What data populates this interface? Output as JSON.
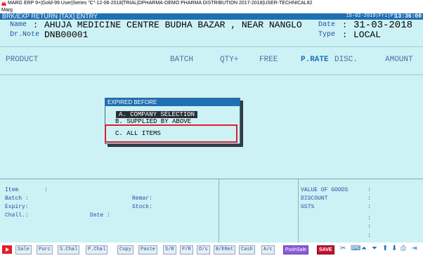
{
  "window": {
    "title": "MARG ERP 9+|Gold-99 User|Series \"C\"-12-06-2018|TRIAL|DPHARMA-DEMO PHARMA DISTRIBUTION 2017-2018|USER-TECHNICAL82",
    "menu": "Marg"
  },
  "header": {
    "title": "BRK/EXP RETURN [TAX] ENTRY",
    "date": "15-02-2019|Fri|P|",
    "time": "13:36:00"
  },
  "party": {
    "name_label": "Name",
    "name_value": "AHUJA MEDICINE CENTRE BUDHA BAZAR , NEAR NANGLO",
    "note_label": "Dr.Note :",
    "note_value": "DNB00001",
    "date_label": "Date",
    "date_value": "31-03-2018",
    "type_label": "Type",
    "type_value": "LOCAL"
  },
  "columns": {
    "product": "PRODUCT",
    "batch": "BATCH",
    "qty": "QTY+",
    "free": "FREE",
    "prate": "P.RATE",
    "disc": "DISC.",
    "amount": "AMOUNT"
  },
  "footer": {
    "item": "Item",
    "batch": "Batch :",
    "expiry": "Expiry:",
    "chall": "Chall.:",
    "date": "Date :",
    "remar": "Remar:",
    "stock": "Stock:",
    "value_of_goods": "VALUE OF GOODS",
    "discount": "DISCOUNT",
    "gst": "GST%"
  },
  "popup": {
    "title": "EXPIRED BEFORE",
    "options": [
      {
        "label": "A. COMPANY SELECTION",
        "selected": true
      },
      {
        "label": "B. SUPPLIED BY ABOVE",
        "selected": false
      },
      {
        "label": "C. ALL ITEMS",
        "selected": false
      }
    ]
  },
  "toolbar": {
    "buttons": [
      "Sale",
      "Purc",
      "S.Chal",
      "P.Chal",
      "Copy",
      "Paste",
      "S/R",
      "P/R",
      "O/s",
      "B/ERet",
      "Cash",
      "A/c"
    ],
    "push_sale": "PushSale",
    "save": "SAVE"
  },
  "colors": {
    "header_bg": "#1f6fb3",
    "panel_bg": "#cdf2f6",
    "highlight": "#e01e2a"
  }
}
